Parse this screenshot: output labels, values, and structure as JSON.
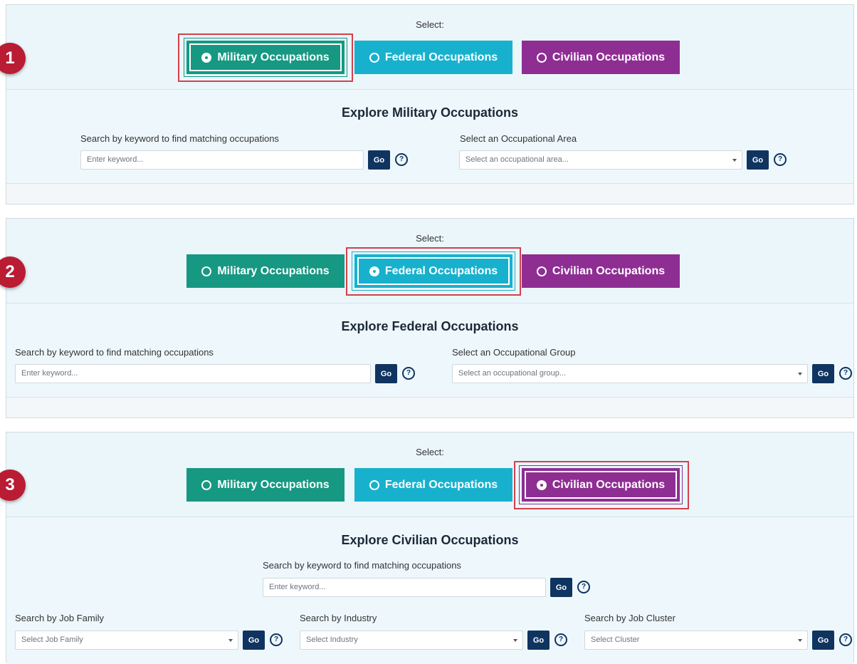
{
  "common": {
    "select_label": "Select:",
    "go_label": "Go",
    "help_glyph": "?",
    "tabs": {
      "military": "Military Occupations",
      "federal": "Federal Occupations",
      "civilian": "Civilian Occupations"
    }
  },
  "colors": {
    "military": "#169882",
    "federal": "#18b1cd",
    "civilian": "#8e2e93",
    "go_button": "#0f3460",
    "badge": "#b91c33",
    "highlight": "#d4404c"
  },
  "panel1": {
    "badge": "1",
    "title": "Explore Military Occupations",
    "keyword_label": "Search by keyword to find matching occupations",
    "keyword_placeholder": "Enter keyword...",
    "area_label": "Select an Occupational Area",
    "area_placeholder": "Select an occupational area..."
  },
  "panel2": {
    "badge": "2",
    "title": "Explore Federal Occupations",
    "keyword_label": "Search by keyword to find matching occupations",
    "keyword_placeholder": "Enter keyword...",
    "group_label": "Select an Occupational Group",
    "group_placeholder": "Select an occupational group..."
  },
  "panel3": {
    "badge": "3",
    "title": "Explore Civilian Occupations",
    "keyword_label": "Search by keyword to find matching occupations",
    "keyword_placeholder": "Enter keyword...",
    "family_label": "Search by Job Family",
    "family_placeholder": "Select Job Family",
    "industry_label": "Search by Industry",
    "industry_placeholder": "Select Industry",
    "cluster_label": "Search by Job Cluster",
    "cluster_placeholder": "Select Cluster"
  }
}
